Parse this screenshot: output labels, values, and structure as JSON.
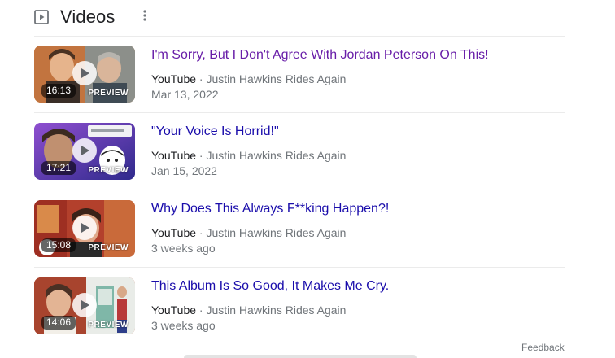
{
  "section": {
    "title": "Videos",
    "icon": "play-box-icon",
    "menu_icon": "more-vert-icon"
  },
  "videos": [
    {
      "title": "I'm Sorry, But I Don't Agree With Jordan Peterson On This!",
      "source": "YouTube",
      "channel": "Justin Hawkins Rides Again",
      "date": "Mar 13, 2022",
      "duration": "16:13",
      "badge": "PREVIEW",
      "visited": true
    },
    {
      "title": "\"Your Voice Is Horrid!\"",
      "source": "YouTube",
      "channel": "Justin Hawkins Rides Again",
      "date": "Jan 15, 2022",
      "duration": "17:21",
      "badge": "PREVIEW",
      "visited": false
    },
    {
      "title": "Why Does This Always F**king Happen?!",
      "source": "YouTube",
      "channel": "Justin Hawkins Rides Again",
      "date": "3 weeks ago",
      "duration": "15:08",
      "badge": "PREVIEW",
      "visited": false
    },
    {
      "title": "This Album Is So Good, It Makes Me Cry.",
      "source": "YouTube",
      "channel": "Justin Hawkins Rides Again",
      "date": "3 weeks ago",
      "duration": "14:06",
      "badge": "PREVIEW",
      "visited": false
    }
  ],
  "source_separator": "·",
  "footer": {
    "feedback_label": "Feedback"
  },
  "colors": {
    "link": "#1a0dab",
    "visited_link": "#681da8",
    "meta_text": "#70757a",
    "divider": "#ebebeb"
  }
}
